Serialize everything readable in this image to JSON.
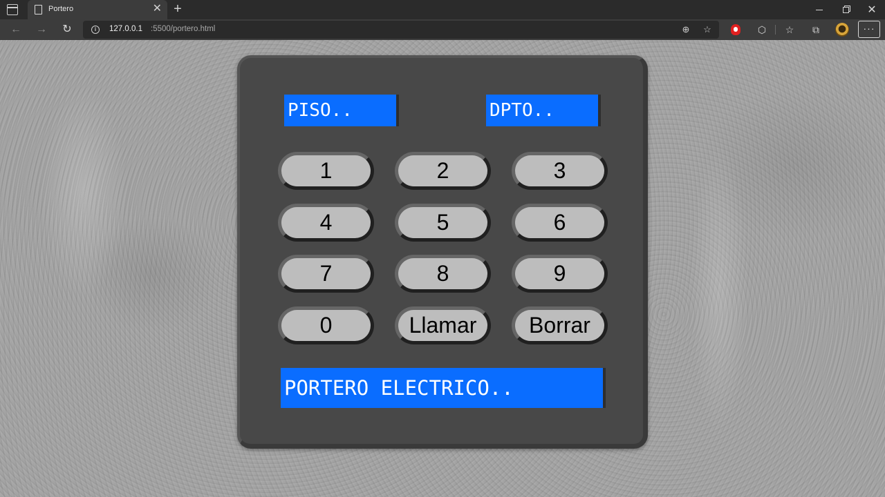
{
  "browser": {
    "tab_title": "Portero",
    "tab_close": "✕",
    "new_tab": "+",
    "url_host": "127.0.0.1",
    "url_path": ":5500/portero.html",
    "more_label": "···"
  },
  "intercom": {
    "piso_display": "PISO..",
    "dpto_display": "DPTO..",
    "main_display": "PORTERO ELECTRICO..",
    "keys": {
      "k1": "1",
      "k2": "2",
      "k3": "3",
      "k4": "4",
      "k5": "5",
      "k6": "6",
      "k7": "7",
      "k8": "8",
      "k9": "9",
      "k0": "0",
      "llamar": "Llamar",
      "borrar": "Borrar"
    }
  }
}
